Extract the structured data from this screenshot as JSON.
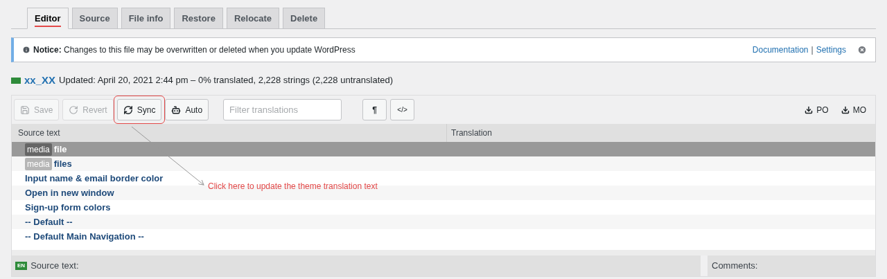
{
  "tabs": [
    {
      "label": "Editor",
      "selected": true
    },
    {
      "label": "Source",
      "selected": false
    },
    {
      "label": "File info",
      "selected": false
    },
    {
      "label": "Restore",
      "selected": false
    },
    {
      "label": "Relocate",
      "selected": false
    },
    {
      "label": "Delete",
      "selected": false
    }
  ],
  "notice": {
    "label": "Notice:",
    "text": "Changes to this file may be overwritten or deleted when you update WordPress",
    "links": [
      "Documentation",
      "Settings"
    ],
    "separator": "|"
  },
  "locale": {
    "code": "xx_XX",
    "summary": "Updated: April 20, 2021 2:44 pm – 0% translated, 2,228 strings (2,228 untranslated)"
  },
  "toolbar": {
    "buttons": [
      {
        "kind": "save",
        "label": "Save",
        "disabled": true,
        "highlighted": false
      },
      {
        "kind": "revert",
        "label": "Revert",
        "disabled": true,
        "highlighted": false
      },
      {
        "kind": "sync",
        "label": "Sync",
        "disabled": false,
        "highlighted": true
      },
      {
        "kind": "auto",
        "label": "Auto",
        "disabled": false,
        "highlighted": false
      }
    ],
    "filter": {
      "placeholder": "Filter translations"
    },
    "toggles": [
      "¶",
      "</>"
    ],
    "downloads": [
      "PO",
      "MO"
    ]
  },
  "table": {
    "columns": [
      "Source text",
      "Translation"
    ],
    "rows": [
      {
        "tag": "media",
        "text": "file",
        "selected": true
      },
      {
        "tag": "media",
        "text": "files",
        "selected": false
      },
      {
        "text": "Input name & email border color",
        "selected": false
      },
      {
        "text": "Open in new window",
        "selected": false
      },
      {
        "text": "Sign-up form colors",
        "selected": false
      },
      {
        "text": "-- Default --",
        "selected": false
      },
      {
        "text": "-- Default Main Navigation --",
        "selected": false
      }
    ]
  },
  "source_panel": {
    "language": "EN",
    "title": "Source text:"
  },
  "comments_panel": {
    "title": "Comments:"
  },
  "annotation": {
    "text": "Click here to update the theme translation text"
  }
}
